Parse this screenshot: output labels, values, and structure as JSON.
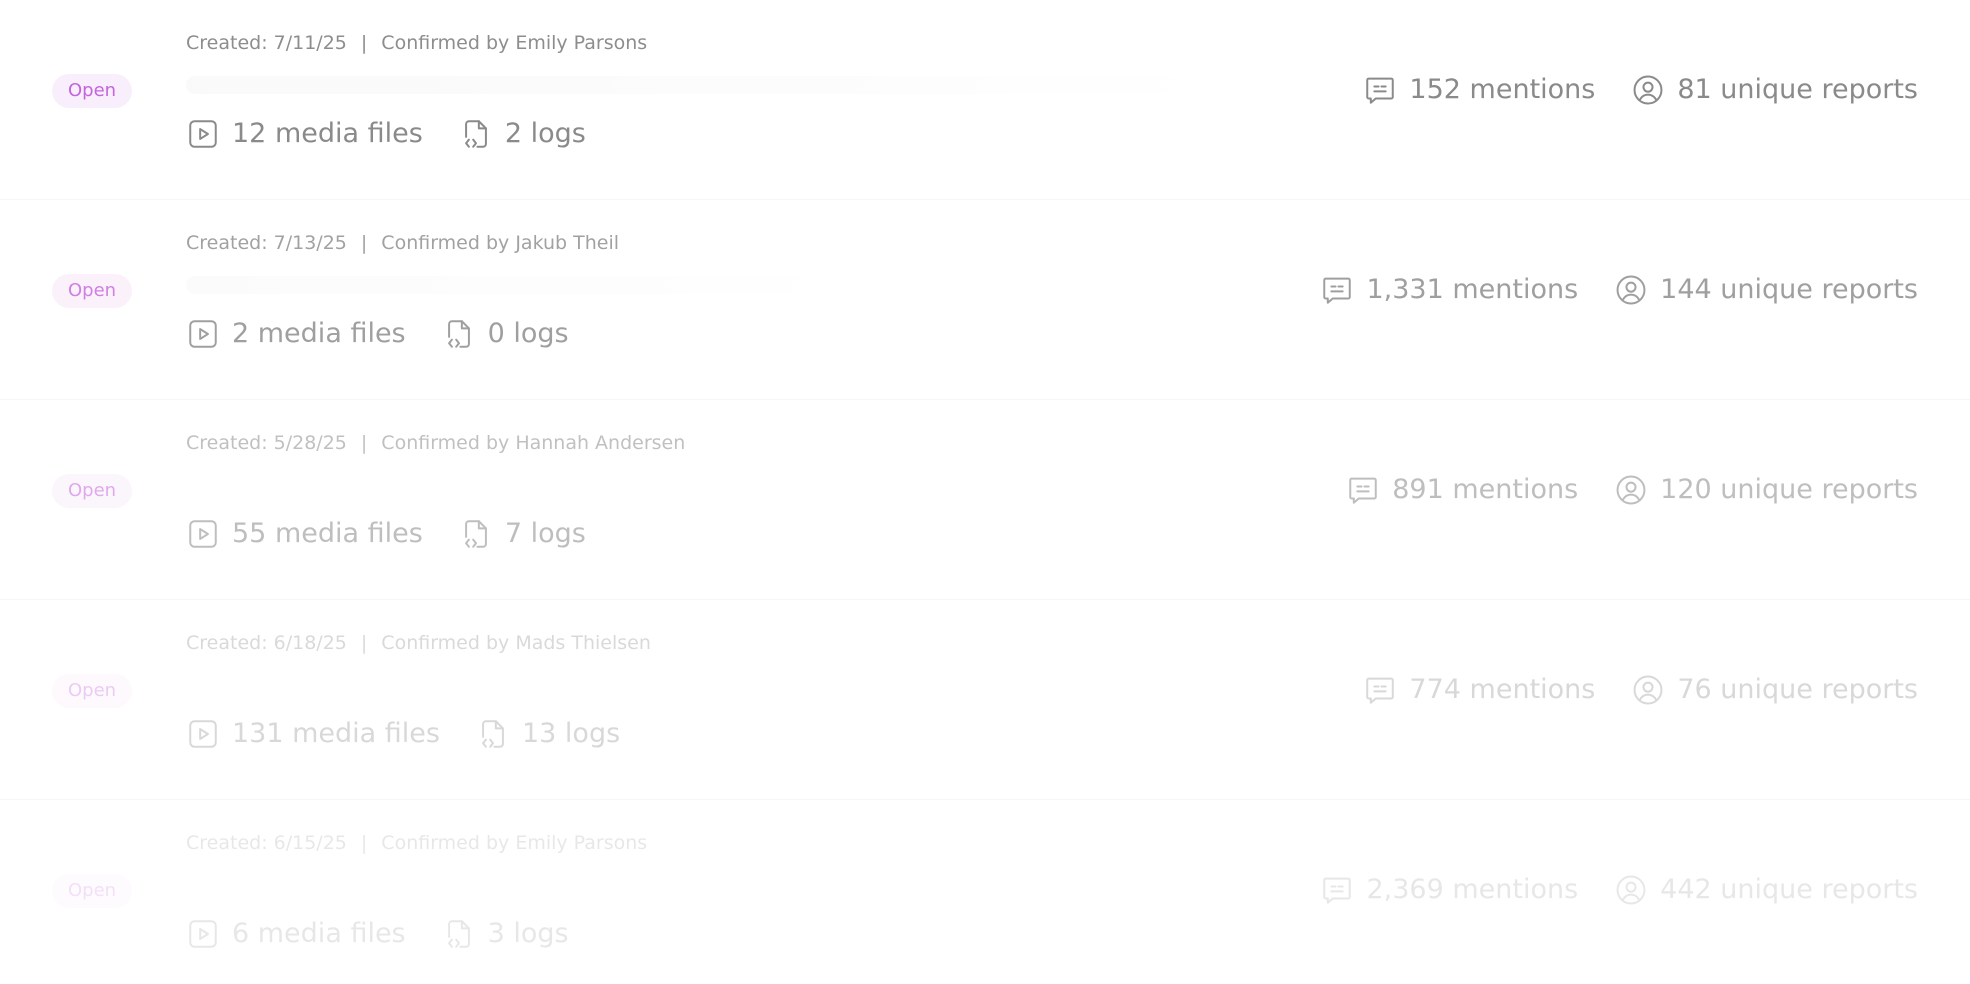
{
  "rows": [
    {
      "status": "Open",
      "created": "Created: 7/11/25",
      "separator": "|",
      "confirmed": "Confirmed by Emily Parsons",
      "media": "12 media files",
      "logs": "2 logs",
      "mentions": "152 mentions",
      "reports": "81 unique reports"
    },
    {
      "status": "Open",
      "created": "Created: 7/13/25",
      "separator": "|",
      "confirmed": "Confirmed by Jakub Theil",
      "media": "2 media files",
      "logs": "0 logs",
      "mentions": "1,331 mentions",
      "reports": "144 unique reports"
    },
    {
      "status": "Open",
      "created": "Created: 5/28/25",
      "separator": "|",
      "confirmed": "Confirmed by Hannah Andersen",
      "media": "55 media files",
      "logs": "7 logs",
      "mentions": "891 mentions",
      "reports": "120 unique reports"
    },
    {
      "status": "Open",
      "created": "Created: 6/18/25",
      "separator": "|",
      "confirmed": "Confirmed by Mads Thielsen",
      "media": "131 media files",
      "logs": "13 logs",
      "mentions": "774 mentions",
      "reports": "76 unique reports"
    },
    {
      "status": "Open",
      "created": "Created: 6/15/25",
      "separator": "|",
      "confirmed": "Confirmed by Emily Parsons",
      "media": "6 media files",
      "logs": "3 logs",
      "mentions": "2,369 mentions",
      "reports": "442 unique reports"
    }
  ],
  "icons": {
    "media": "play-square-icon",
    "logs": "code-file-icon",
    "mentions": "message-square-icon",
    "reports": "user-circle-icon"
  },
  "colors": {
    "status_text": "#c465de",
    "status_bg": "#f9eefb",
    "muted_text": "#8a8a8a"
  }
}
